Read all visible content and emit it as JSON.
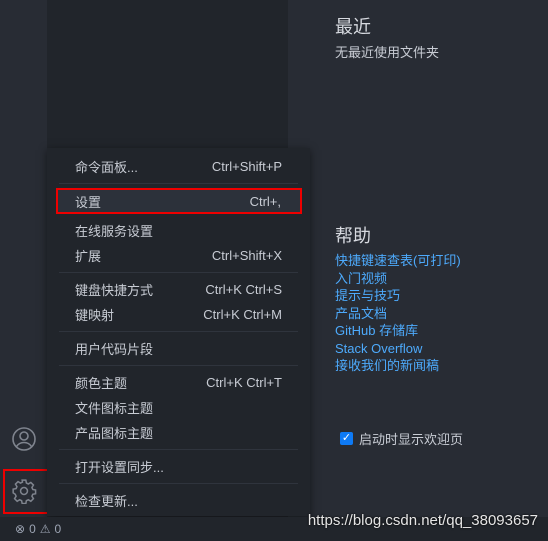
{
  "menu": {
    "items": [
      {
        "label": "命令面板...",
        "shortcut": "Ctrl+Shift+P"
      },
      {
        "label": "设置",
        "shortcut": "Ctrl+,"
      },
      {
        "label": "在线服务设置",
        "shortcut": ""
      },
      {
        "label": "扩展",
        "shortcut": "Ctrl+Shift+X"
      },
      {
        "label": "键盘快捷方式",
        "shortcut": "Ctrl+K Ctrl+S"
      },
      {
        "label": "键映射",
        "shortcut": "Ctrl+K Ctrl+M"
      },
      {
        "label": "用户代码片段",
        "shortcut": ""
      },
      {
        "label": "颜色主题",
        "shortcut": "Ctrl+K Ctrl+T"
      },
      {
        "label": "文件图标主题",
        "shortcut": ""
      },
      {
        "label": "产品图标主题",
        "shortcut": ""
      },
      {
        "label": "打开设置同步...",
        "shortcut": ""
      },
      {
        "label": "检查更新...",
        "shortcut": ""
      }
    ]
  },
  "welcome": {
    "recent_title": "最近",
    "recent_empty": "无最近使用文件夹",
    "help_title": "帮助",
    "help_links": [
      "快捷键速查表(可打印)",
      "入门视频",
      "提示与技巧",
      "产品文档",
      "GitHub 存储库",
      "Stack Overflow",
      "接收我们的新闻稿"
    ],
    "startup_label": "启动时显示欢迎页",
    "startup_checked": true
  },
  "status": {
    "errors": "0",
    "warnings": "0"
  },
  "watermark": "https://blog.csdn.net/qq_38093657"
}
